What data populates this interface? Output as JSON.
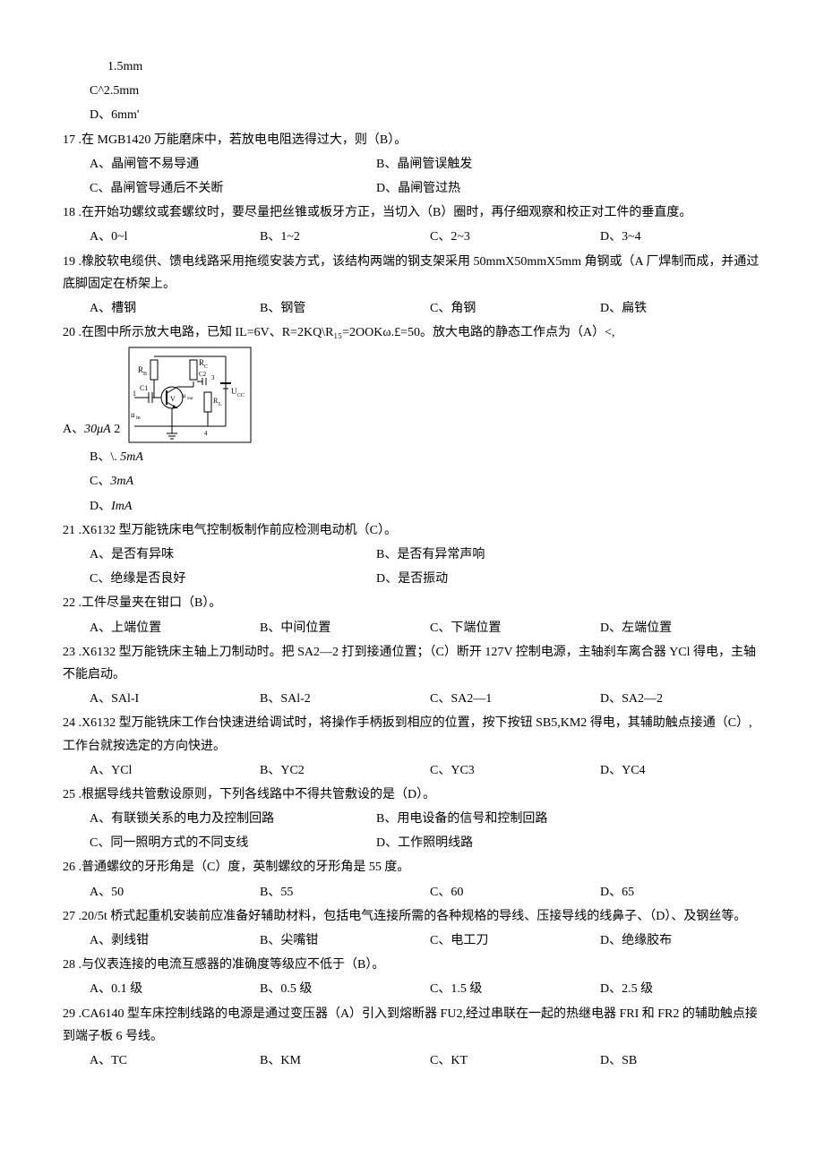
{
  "pre": {
    "l1": "1.5mm",
    "l2": "C^2.5mm",
    "l3": "D、6mm'"
  },
  "q17": {
    "text": "17 .在 MGB1420 万能磨床中，若放电电阻选得过大，则（B）。",
    "a": "A、晶闸管不易导通",
    "b": "B、晶闸管误触发",
    "c": "C、晶闸管导通后不关断",
    "d": "D、晶闸管过热"
  },
  "q18": {
    "text": "18 .在开始功螺纹或套螺纹时，要尽量把丝锥或板牙方正，当切入（B）圈时，再仔细观察和校正对工件的垂直度。",
    "a": "A、0~l",
    "b": "B、1~2",
    "c": "C、2~3",
    "d": "D、3~4"
  },
  "q19": {
    "text": "19 .橡胶软电缆供、馈电线路采用拖缆安装方式，该结构两端的钢支架采用 50mmX50mmX5mm 角钢或（A 厂焊制而成，并通过底脚固定在桥架上。",
    "a": "A、槽钢",
    "b": "B、钢管",
    "c": "C、角钢",
    "d": "D、扁铁"
  },
  "q20": {
    "text": "20 .在图中所示放大电路，已知 IL=6V、R=2KQ\\R₁₅=2OOKω.£=50。放大电路的静态工作点为（A）<,",
    "a_label": "A、30μA",
    "b": "B、\\. 5mA",
    "c": "C、3mA",
    "d": "D、ImA",
    "a_label_suffix": "2"
  },
  "q21": {
    "text": "21 .X6132 型万能铣床电气控制板制作前应检测电动机（C）。",
    "a": "A、是否有异味",
    "b": "B、是否有异常声响",
    "c": "C、绝缘是否良好",
    "d": "D、是否振动"
  },
  "q22": {
    "text": "22 .工件尽量夹在钳口（B）。",
    "a": "A、上端位置",
    "b": "B、中间位置",
    "c": "C、下端位置",
    "d": "D、左端位置"
  },
  "q23": {
    "text": "23 .X6132 型万能铣床主轴上刀制动时。把 SA2—2 打到接通位置；（C）断开 127V 控制电源，主轴刹车离合器 YCl 得电，主轴不能启动。",
    "a": "A、SAl-I",
    "b": "B、SAl-2",
    "c": "C、SA2—1",
    "d": "D、SA2—2"
  },
  "q24": {
    "text": "24 .X6132 型万能铣床工作台快速进给调试时，将操作手柄扳到相应的位置，按下按钮 SB5,KM2 得电，其辅助触点接通（C）, 工作台就按选定的方向快进。",
    "a": "A、YCl",
    "b": "B、YC2",
    "c": "C、YC3",
    "d": "D、YC4"
  },
  "q25": {
    "text": "25 .根据导线共管敷设原则，下列各线路中不得共管敷设的是（D）。",
    "a": "A、有联锁关系的电力及控制回路",
    "b": "B、用电设备的信号和控制回路",
    "c": "C、同一照明方式的不同支线",
    "d": "D、工作照明线路"
  },
  "q26": {
    "text": "26 .普通螺纹的牙形角是（C）度，英制螺纹的牙形角是 55 度。",
    "a": "A、50",
    "b": "B、55",
    "c": "C、60",
    "d": "D、65"
  },
  "q27": {
    "text": "27 .20/5t 桥式起重机安装前应准备好辅助材料，包括电气连接所需的各种规格的导线、压接导线的线鼻子、（D）、及钢丝等。",
    "a": "A、剥线钳",
    "b": "B、尖嘴钳",
    "c": "C、电工刀",
    "d": "D、绝缘胶布"
  },
  "q28": {
    "text": "28 .与仪表连接的电流互感器的准确度等级应不低于（B）。",
    "a": "A、0.1 级",
    "b": "B、0.5 级",
    "c": "C、1.5 级",
    "d": "D、2.5 级"
  },
  "q29": {
    "text": "29 .CA6140 型车床控制线路的电源是通过变压器（A）引入到熔断器 FU2,经过串联在一起的热继电器 FRI 和 FR2 的辅助触点接到端子板 6 号线。",
    "a": "A、TC",
    "b": "B、KM",
    "c": "C、KT",
    "d": "D、SB"
  },
  "circuit_labels": {
    "rb": "R_B",
    "rc": "R_C",
    "c1": "C1",
    "c2": "C2",
    "v": "V",
    "rl": "R_L",
    "ucc": "U_CC",
    "uout": "u_out",
    "uin": "u_in",
    "n1": "1",
    "n2": "2",
    "n3": "3",
    "n4": "4"
  }
}
